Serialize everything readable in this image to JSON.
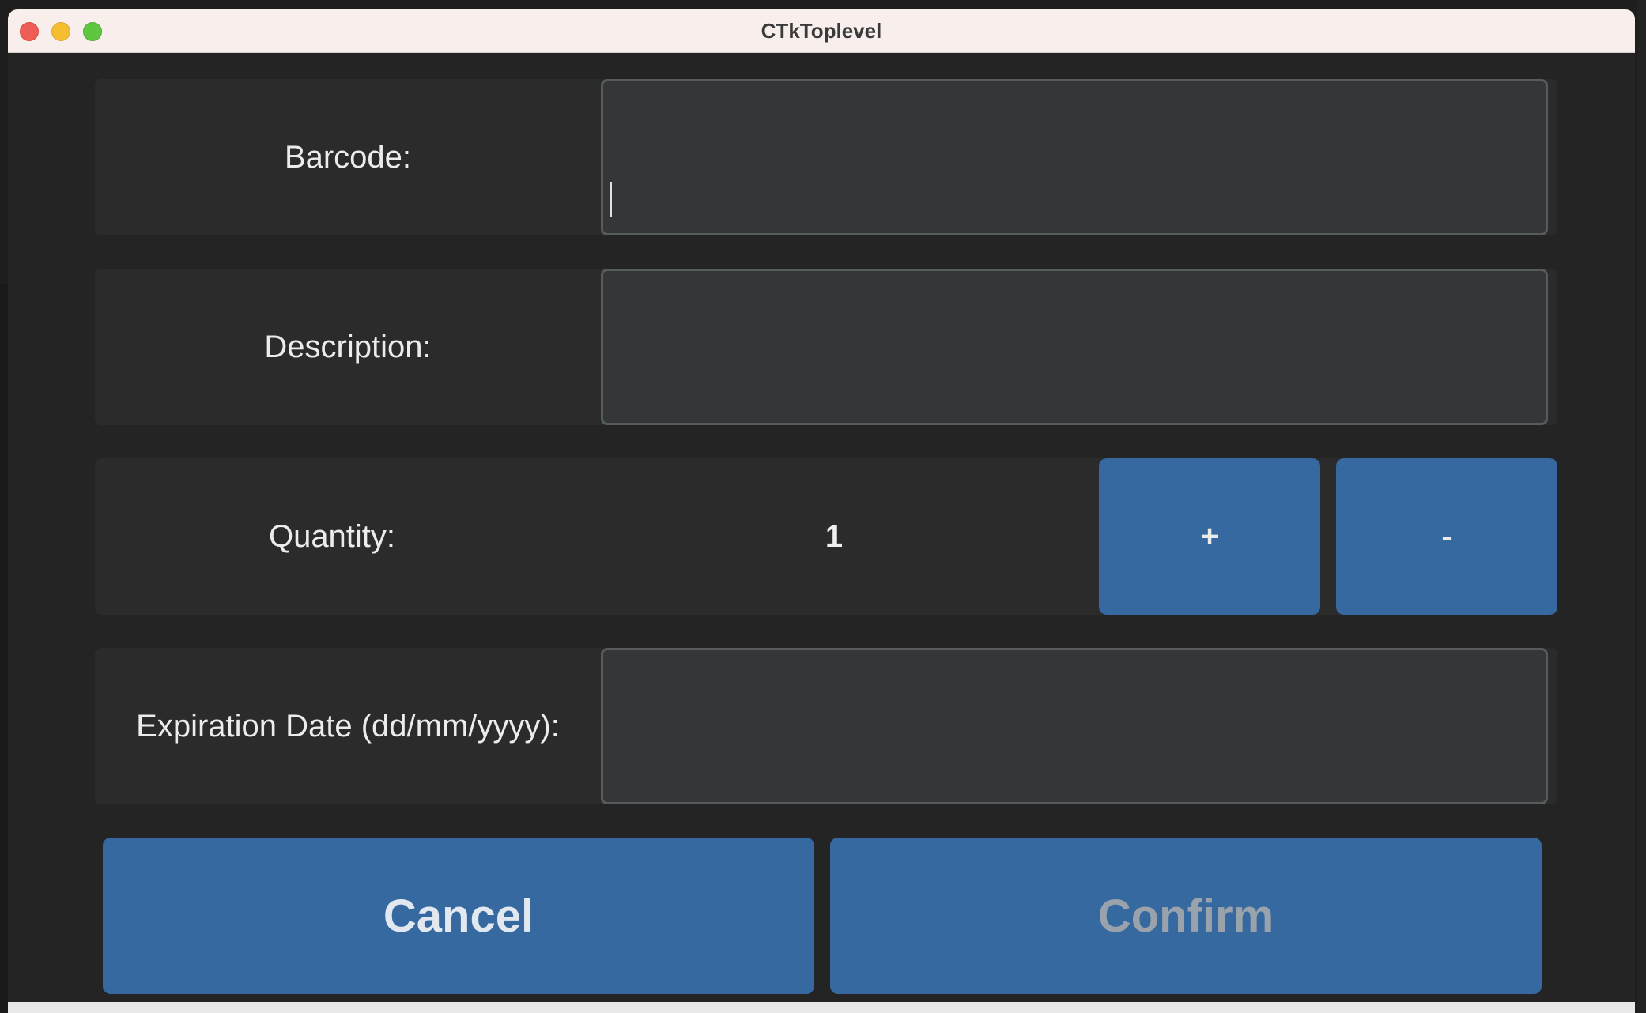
{
  "window": {
    "title": "CTkToplevel"
  },
  "form": {
    "barcode": {
      "label": "Barcode:",
      "value": ""
    },
    "description": {
      "label": "Description:",
      "value": ""
    },
    "quantity": {
      "label": "Quantity:",
      "value": "1",
      "plus_label": "+",
      "minus_label": "-"
    },
    "expiration": {
      "label": "Expiration Date (dd/mm/yyyy):",
      "value": ""
    }
  },
  "actions": {
    "cancel_label": "Cancel",
    "confirm_label": "Confirm"
  },
  "colors": {
    "button": "#3669a0",
    "entry_bg": "#343638",
    "entry_border": "#565b5e",
    "frame_bg": "#2b2b2b",
    "window_bg": "#242424"
  }
}
